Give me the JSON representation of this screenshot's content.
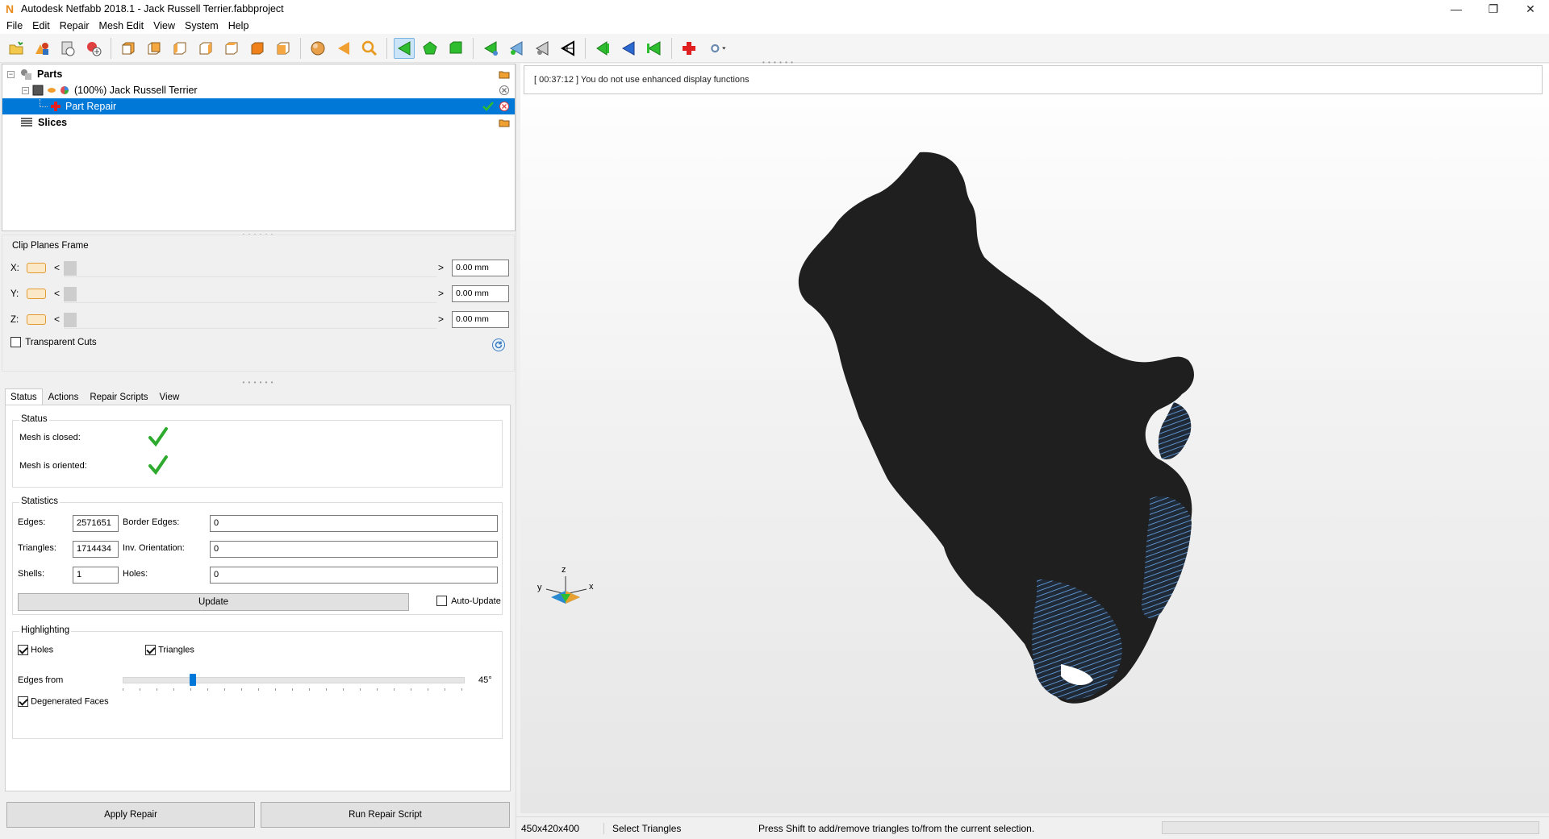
{
  "window": {
    "title": "Autodesk Netfabb 2018.1 - Jack Russell Terrier.fabbproject",
    "logo": "N"
  },
  "menu": [
    "File",
    "Edit",
    "Repair",
    "Mesh Edit",
    "View",
    "System",
    "Help"
  ],
  "toolbar_icons": [
    "add-part-icon",
    "shapes-icon",
    "library-icon",
    "add-repair-icon",
    "view-front-icon",
    "view-back-icon",
    "view-left-icon",
    "view-right-icon",
    "view-top-icon",
    "view-bottom-icon",
    "view-iso-icon",
    "sphere-icon",
    "triangle-orange-icon",
    "zoom-icon",
    "select-triangle-icon",
    "select-shell-icon",
    "select-surface-icon",
    "edge-tool-icon",
    "edge-add-icon",
    "edge-gray-icon",
    "edge-black-icon",
    "nav-back-icon",
    "nav-blue-icon",
    "nav-forward-icon",
    "repair-cross-icon",
    "settings-dropdown-icon"
  ],
  "tree": {
    "parts_label": "Parts",
    "part_name": "(100%) Jack Russell Terrier",
    "repair_label": "Part Repair",
    "slices_label": "Slices"
  },
  "clip": {
    "frame_label": "Clip Planes Frame",
    "rows": [
      {
        "axis": "X:",
        "value": "0.00 mm"
      },
      {
        "axis": "Y:",
        "value": "0.00 mm"
      },
      {
        "axis": "Z:",
        "value": "0.00 mm"
      }
    ],
    "arrow_left": "<",
    "arrow_right": ">",
    "transparent_label": "Transparent Cuts",
    "transparent_checked": false
  },
  "tabs": [
    "Status",
    "Actions",
    "Repair Scripts",
    "View"
  ],
  "status": {
    "group_label": "Status",
    "closed_label": "Mesh is closed:",
    "oriented_label": "Mesh is oriented:"
  },
  "statistics": {
    "group_label": "Statistics",
    "edges_label": "Edges:",
    "edges": "2571651",
    "border_edges_label": "Border Edges:",
    "border_edges": "0",
    "triangles_label": "Triangles:",
    "triangles": "1714434",
    "inv_orientation_label": "Inv. Orientation:",
    "inv_orientation": "0",
    "shells_label": "Shells:",
    "shells": "1",
    "holes_label": "Holes:",
    "holes": "0",
    "update_label": "Update",
    "auto_update_label": "Auto-Update"
  },
  "highlighting": {
    "group_label": "Highlighting",
    "holes_label": "Holes",
    "triangles_label": "Triangles",
    "edges_from_label": "Edges from",
    "edges_from_value": "45°",
    "edges_from_fraction": 0.2,
    "degenerated_label": "Degenerated Faces"
  },
  "buttons": {
    "apply_repair": "Apply Repair",
    "run_repair_script": "Run Repair Script"
  },
  "viewport": {
    "log": "[ 00:37:12 ] You do not use enhanced display functions",
    "axis_z": "z",
    "axis_y": "y",
    "axis_x": "x"
  },
  "statusbar": {
    "dimensions": "450x420x400",
    "mode": "Select Triangles",
    "hint": "Press Shift to add/remove triangles to/from the current selection."
  },
  "colors": {
    "selection": "#0078d7",
    "mesh": "#1f1f1f",
    "mesh_highlight": "#5b8fc9",
    "check_green": "#2eab2e"
  }
}
